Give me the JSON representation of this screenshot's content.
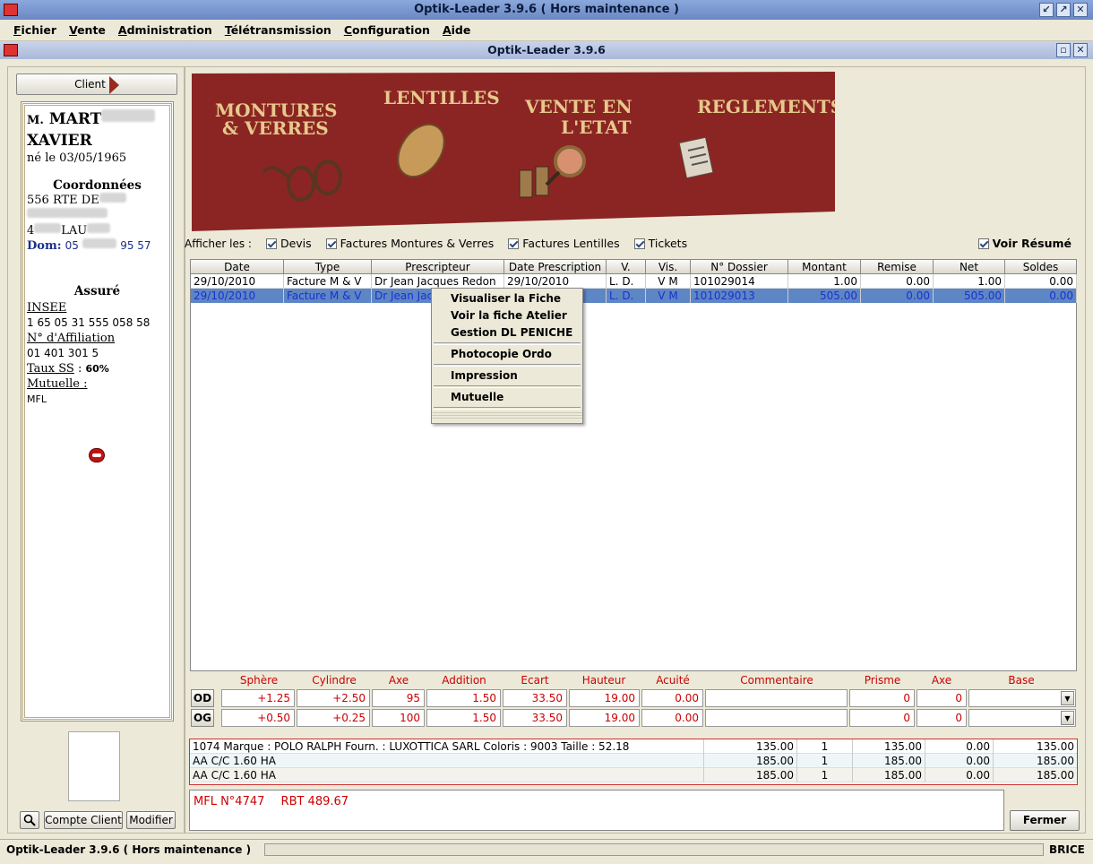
{
  "window": {
    "title": "Optik-Leader 3.9.6 ( Hors maintenance )"
  },
  "menu": [
    "Fichier",
    "Vente",
    "Administration",
    "Télétransmission",
    "Configuration",
    "Aide"
  ],
  "inner_window": {
    "title": "Optik-Leader 3.9.6"
  },
  "client_button": "Client",
  "client": {
    "civility": "M.",
    "lastname": "MART",
    "firstname": "XAVIER",
    "birth": "né le 03/05/1965",
    "coords_title": "Coordonnées",
    "address1": "556 RTE DE",
    "city_prefix": "4",
    "city": "LAU",
    "phone_label": "Dom:",
    "phone_prefix": "05",
    "phone_suffix": "95 57",
    "insured_title": "Assuré",
    "insee_label": "INSEE",
    "insee": "1 65 05 31 555 058 58",
    "affiliation_label": "N° d'Affiliation",
    "affiliation": "01 401 301 5",
    "taux_label": "Taux SS",
    "taux": "60%",
    "mutuelle_label": "Mutuelle :",
    "mutuelle": "MFL"
  },
  "left_buttons": {
    "compte": "Compte Client",
    "modifier": "Modifier"
  },
  "banner": {
    "montures": [
      "MONTURES",
      "& VERRES"
    ],
    "lentilles": "LENTILLES",
    "vente": [
      "VENTE EN",
      "L'ETAT"
    ],
    "reglements": "REGLEMENTS"
  },
  "filters": {
    "label": "Afficher les :",
    "devis": "Devis",
    "factures_mv": "Factures Montures & Verres",
    "factures_l": "Factures Lentilles",
    "tickets": "Tickets",
    "resume": "Voir Résumé"
  },
  "grid": {
    "columns": [
      "Date",
      "Type",
      "Prescripteur",
      "Date Prescription",
      "V.",
      "Vis.",
      "N° Dossier",
      "Montant",
      "Remise",
      "Net",
      "Soldes"
    ],
    "rows": [
      [
        "29/10/2010",
        "Facture M & V",
        "Dr Jean Jacques Redon",
        "29/10/2010",
        "L. D.",
        "V M",
        "101029014",
        "1.00",
        "0.00",
        "1.00",
        "0.00"
      ],
      [
        "29/10/2010",
        "Facture M & V",
        "Dr Jean Jac",
        "",
        "L. D.",
        "V M",
        "101029013",
        "505.00",
        "0.00",
        "505.00",
        "0.00"
      ]
    ]
  },
  "context_menu": [
    "Visualiser la Fiche",
    "Voir la fiche Atelier",
    "Gestion DL PENICHE",
    "Photocopie Ordo",
    "Impression",
    "Mutuelle"
  ],
  "rx": {
    "headers": [
      "Sphère",
      "Cylindre",
      "Axe",
      "Addition",
      "Ecart",
      "Hauteur",
      "Acuité",
      "Commentaire",
      "Prisme",
      "Axe",
      "Base"
    ],
    "od": {
      "label": "OD",
      "values": [
        "+1.25",
        "+2.50",
        "95",
        "1.50",
        "33.50",
        "19.00",
        "0.00",
        "",
        "0",
        "0",
        ""
      ]
    },
    "og": {
      "label": "OG",
      "values": [
        "+0.50",
        "+0.25",
        "100",
        "1.50",
        "33.50",
        "19.00",
        "0.00",
        "",
        "0",
        "0",
        ""
      ]
    }
  },
  "lines": [
    [
      "1074   Marque : POLO RALPH   Fourn. : LUXOTTICA SARL   Coloris : 9003   Taille : 52.18",
      "135.00",
      "1",
      "135.00",
      "0.00",
      "135.00"
    ],
    [
      "AA C/C 1.60 HA",
      "185.00",
      "1",
      "185.00",
      "0.00",
      "185.00"
    ],
    [
      "AA C/C 1.60 HA",
      "185.00",
      "1",
      "185.00",
      "0.00",
      "185.00"
    ]
  ],
  "memo": {
    "mfl": "MFL N°4747",
    "rbt": "RBT 489.67"
  },
  "fermer": "Fermer",
  "status": {
    "left": "Optik-Leader 3.9.6 ( Hors maintenance )",
    "user": "BRICE"
  },
  "colors": {
    "banner": "#8b2523",
    "banner_text": "#e6c98c",
    "selected_row": "#5d86c4",
    "red_text": "#cc0000"
  }
}
